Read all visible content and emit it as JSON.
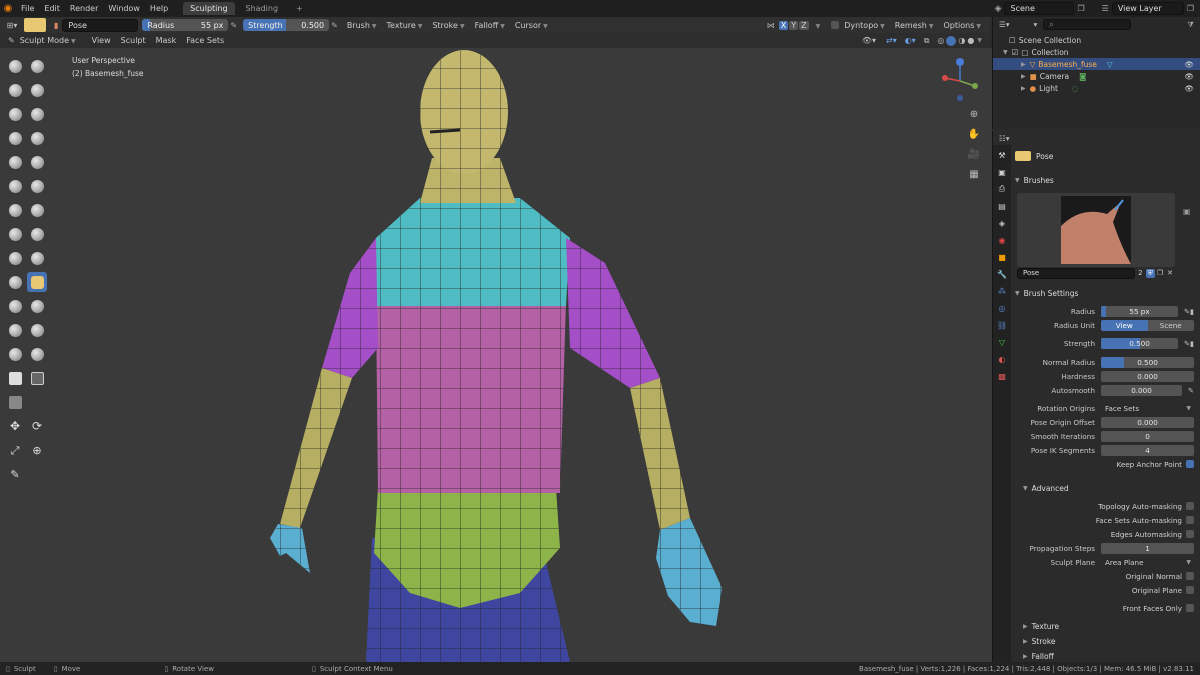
{
  "menu": {
    "items": [
      "File",
      "Edit",
      "Render",
      "Window",
      "Help"
    ],
    "tabs": [
      "Sculpting",
      "Shading"
    ],
    "scene": "Scene",
    "view_layer": "View Layer"
  },
  "header": {
    "brush": "Pose",
    "radius_label": "Radius",
    "radius_value": "55 px",
    "strength_label": "Strength",
    "strength_value": "0.500",
    "menus": [
      "Brush",
      "Texture",
      "Stroke",
      "Falloff",
      "Cursor"
    ],
    "axes": [
      "X",
      "Y",
      "Z"
    ],
    "dyntopo": "Dyntopo",
    "remesh": "Remesh",
    "options": "Options"
  },
  "header2": {
    "mode": "Sculpt Mode",
    "items": [
      "View",
      "Sculpt",
      "Mask",
      "Face Sets"
    ]
  },
  "viewport": {
    "line1": "User Perspective",
    "line2": "(2) Basemesh_fuse",
    "accent": "#4772b3"
  },
  "tools": [
    "draw",
    "draw-sharp",
    "clay",
    "clay-strips",
    "clay-thumb",
    "layer",
    "inflate",
    "blob",
    "crease",
    "smooth",
    "flatten",
    "fill",
    "scrape",
    "multiplane-scrape",
    "pinch",
    "grab",
    "elastic-deform",
    "snake-hook",
    "thumb",
    "pose",
    "nudge",
    "rotate",
    "slide-relax",
    "boundary",
    "cloth",
    "simplify",
    "mask",
    "draw-face-sets",
    "box-mask",
    "lasso-mask",
    "move",
    "rotate",
    "scale",
    "transform",
    "annotate"
  ],
  "outliner": {
    "root": "Scene Collection",
    "collection": "Collection",
    "objects": [
      {
        "name": "Basemesh_fuse",
        "selected": true
      },
      {
        "name": "Camera",
        "selected": false
      },
      {
        "name": "Light",
        "selected": false
      }
    ]
  },
  "props": {
    "brush_name": "Pose",
    "brushes_title": "Brushes",
    "brush_field": "Pose",
    "brush_users": "2",
    "brush_settings": "Brush Settings",
    "radius_label": "Radius",
    "radius": "55 px",
    "radius_unit_label": "Radius Unit",
    "unit_view": "View",
    "unit_scene": "Scene",
    "strength_label": "Strength",
    "strength": "0.500",
    "normal_radius_label": "Normal Radius",
    "normal_radius": "0.500",
    "hardness_label": "Hardness",
    "hardness": "0.000",
    "autosmooth_label": "Autosmooth",
    "autosmooth": "0.000",
    "rotation_origins_label": "Rotation Origins",
    "rotation_origins": "Face Sets",
    "pose_origin_offset_label": "Pose Origin Offset",
    "pose_origin_offset": "0.000",
    "smooth_iterations_label": "Smooth Iterations",
    "smooth_iterations": "0",
    "pose_ik_label": "Pose IK Segments",
    "pose_ik": "4",
    "keep_anchor": "Keep Anchor Point",
    "advanced": "Advanced",
    "topology_auto": "Topology Auto-masking",
    "face_sets_auto": "Face Sets Auto-masking",
    "edges_auto": "Edges Automasking",
    "propagation_label": "Propagation Steps",
    "propagation": "1",
    "sculpt_plane_label": "Sculpt Plane",
    "sculpt_plane": "Area Plane",
    "original_normal": "Original Normal",
    "original_plane": "Original Plane",
    "front_faces": "Front Faces Only",
    "texture": "Texture",
    "stroke": "Stroke",
    "falloff": "Falloff"
  },
  "status": {
    "left": "Sculpt",
    "move": "Move",
    "rotate": "Rotate View",
    "context": "Sculpt Context Menu",
    "info": "Basemesh_fuse | Verts:1,226 | Faces:1,224 | Tris:2,448 | Objects:1/3 | Mem: 46.5 MiB | v2.83.11"
  }
}
